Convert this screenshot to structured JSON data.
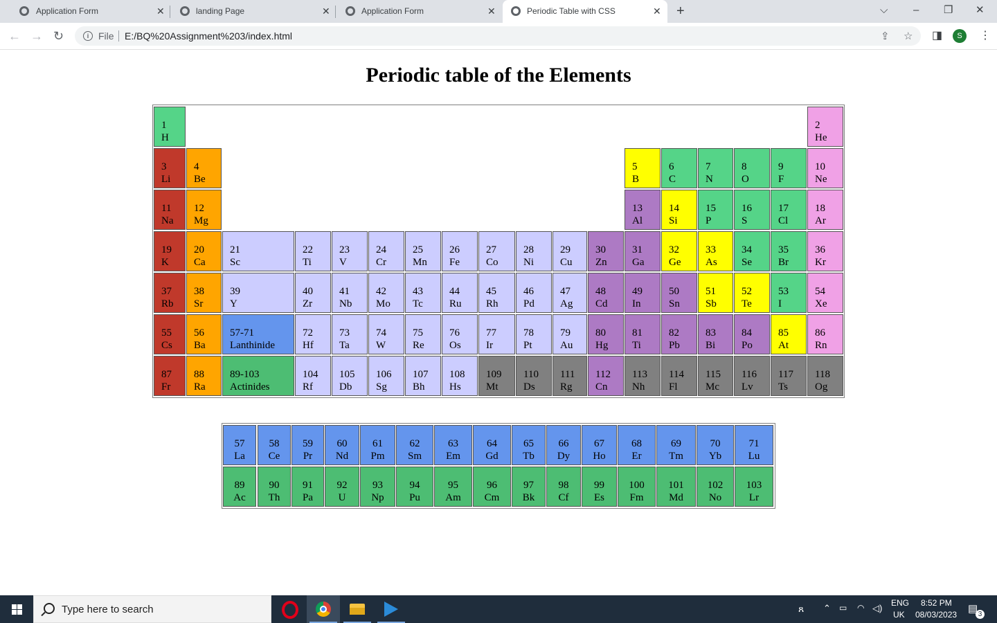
{
  "browser": {
    "tabs": [
      {
        "title": "Application Form",
        "close": "✕"
      },
      {
        "title": "landing Page",
        "close": "✕"
      },
      {
        "title": "Application Form",
        "close": "✕"
      },
      {
        "title": "Periodic Table with CSS",
        "close": "✕"
      }
    ],
    "new_tab": "+",
    "window_controls": {
      "tab_search": "⌵",
      "minimize": "–",
      "restore": "❐",
      "close": "✕"
    },
    "nav": {
      "back": "←",
      "forward": "→",
      "reload": "↻"
    },
    "omnibox": {
      "info": "i",
      "scheme": "File",
      "url": "E:/BQ%20Assignment%203/index.html"
    },
    "profile_initial": "S"
  },
  "page": {
    "title": "Periodic table of the Elements"
  },
  "colors": {
    "alkali": "#c0392b",
    "alkaline": "#ffa500",
    "transition": "#cccdff",
    "post_transition": "#ad7ac4",
    "metalloid": "#ffff00",
    "nonmetal": "#55d488",
    "noble": "#f0a1e6",
    "lanthanide": "#6495ed",
    "actinide": "#4dbd73",
    "unknown": "#808080"
  },
  "main_table": [
    {
      "num": "1",
      "sym": "H",
      "cat": "nonmetal",
      "row": 1,
      "col": 1
    },
    {
      "num": "2",
      "sym": "He",
      "cat": "noble",
      "row": 1,
      "col": 18
    },
    {
      "num": "3",
      "sym": "Li",
      "cat": "alkali",
      "row": 2,
      "col": 1
    },
    {
      "num": "4",
      "sym": "Be",
      "cat": "alkaline",
      "row": 2,
      "col": 2
    },
    {
      "num": "5",
      "sym": "B",
      "cat": "metalloid",
      "row": 2,
      "col": 13
    },
    {
      "num": "6",
      "sym": "C",
      "cat": "nonmetal",
      "row": 2,
      "col": 14
    },
    {
      "num": "7",
      "sym": "N",
      "cat": "nonmetal",
      "row": 2,
      "col": 15
    },
    {
      "num": "8",
      "sym": "O",
      "cat": "nonmetal",
      "row": 2,
      "col": 16
    },
    {
      "num": "9",
      "sym": "F",
      "cat": "nonmetal",
      "row": 2,
      "col": 17
    },
    {
      "num": "10",
      "sym": "Ne",
      "cat": "noble",
      "row": 2,
      "col": 18
    },
    {
      "num": "11",
      "sym": "Na",
      "cat": "alkali",
      "row": 3,
      "col": 1
    },
    {
      "num": "12",
      "sym": "Mg",
      "cat": "alkaline",
      "row": 3,
      "col": 2
    },
    {
      "num": "13",
      "sym": "Al",
      "cat": "post_transition",
      "row": 3,
      "col": 13
    },
    {
      "num": "14",
      "sym": "Si",
      "cat": "metalloid",
      "row": 3,
      "col": 14
    },
    {
      "num": "15",
      "sym": "P",
      "cat": "nonmetal",
      "row": 3,
      "col": 15
    },
    {
      "num": "16",
      "sym": "S",
      "cat": "nonmetal",
      "row": 3,
      "col": 16
    },
    {
      "num": "17",
      "sym": "Cl",
      "cat": "nonmetal",
      "row": 3,
      "col": 17
    },
    {
      "num": "18",
      "sym": "Ar",
      "cat": "noble",
      "row": 3,
      "col": 18
    },
    {
      "num": "19",
      "sym": "K",
      "cat": "alkali",
      "row": 4,
      "col": 1
    },
    {
      "num": "20",
      "sym": "Ca",
      "cat": "alkaline",
      "row": 4,
      "col": 2
    },
    {
      "num": "21",
      "sym": "Sc",
      "cat": "transition",
      "row": 4,
      "col": 3
    },
    {
      "num": "22",
      "sym": "Ti",
      "cat": "transition",
      "row": 4,
      "col": 4
    },
    {
      "num": "23",
      "sym": "V",
      "cat": "transition",
      "row": 4,
      "col": 5
    },
    {
      "num": "24",
      "sym": "Cr",
      "cat": "transition",
      "row": 4,
      "col": 6
    },
    {
      "num": "25",
      "sym": "Mn",
      "cat": "transition",
      "row": 4,
      "col": 7
    },
    {
      "num": "26",
      "sym": "Fe",
      "cat": "transition",
      "row": 4,
      "col": 8
    },
    {
      "num": "27",
      "sym": "Co",
      "cat": "transition",
      "row": 4,
      "col": 9
    },
    {
      "num": "28",
      "sym": "Ni",
      "cat": "transition",
      "row": 4,
      "col": 10
    },
    {
      "num": "29",
      "sym": "Cu",
      "cat": "transition",
      "row": 4,
      "col": 11
    },
    {
      "num": "30",
      "sym": "Zn",
      "cat": "post_transition",
      "row": 4,
      "col": 12
    },
    {
      "num": "31",
      "sym": "Ga",
      "cat": "post_transition",
      "row": 4,
      "col": 13
    },
    {
      "num": "32",
      "sym": "Ge",
      "cat": "metalloid",
      "row": 4,
      "col": 14
    },
    {
      "num": "33",
      "sym": "As",
      "cat": "metalloid",
      "row": 4,
      "col": 15
    },
    {
      "num": "34",
      "sym": "Se",
      "cat": "nonmetal",
      "row": 4,
      "col": 16
    },
    {
      "num": "35",
      "sym": "Br",
      "cat": "nonmetal",
      "row": 4,
      "col": 17
    },
    {
      "num": "36",
      "sym": "Kr",
      "cat": "noble",
      "row": 4,
      "col": 18
    },
    {
      "num": "37",
      "sym": "Rb",
      "cat": "alkali",
      "row": 5,
      "col": 1
    },
    {
      "num": "38",
      "sym": "Sr",
      "cat": "alkaline",
      "row": 5,
      "col": 2
    },
    {
      "num": "39",
      "sym": "Y",
      "cat": "transition",
      "row": 5,
      "col": 3
    },
    {
      "num": "40",
      "sym": "Zr",
      "cat": "transition",
      "row": 5,
      "col": 4
    },
    {
      "num": "41",
      "sym": "Nb",
      "cat": "transition",
      "row": 5,
      "col": 5
    },
    {
      "num": "42",
      "sym": "Mo",
      "cat": "transition",
      "row": 5,
      "col": 6
    },
    {
      "num": "43",
      "sym": "Tc",
      "cat": "transition",
      "row": 5,
      "col": 7
    },
    {
      "num": "44",
      "sym": "Ru",
      "cat": "transition",
      "row": 5,
      "col": 8
    },
    {
      "num": "45",
      "sym": "Rh",
      "cat": "transition",
      "row": 5,
      "col": 9
    },
    {
      "num": "46",
      "sym": "Pd",
      "cat": "transition",
      "row": 5,
      "col": 10
    },
    {
      "num": "47",
      "sym": "Ag",
      "cat": "transition",
      "row": 5,
      "col": 11
    },
    {
      "num": "48",
      "sym": "Cd",
      "cat": "post_transition",
      "row": 5,
      "col": 12
    },
    {
      "num": "49",
      "sym": "In",
      "cat": "post_transition",
      "row": 5,
      "col": 13
    },
    {
      "num": "50",
      "sym": "Sn",
      "cat": "post_transition",
      "row": 5,
      "col": 14
    },
    {
      "num": "51",
      "sym": "Sb",
      "cat": "metalloid",
      "row": 5,
      "col": 15
    },
    {
      "num": "52",
      "sym": "Te",
      "cat": "metalloid",
      "row": 5,
      "col": 16
    },
    {
      "num": "53",
      "sym": "I",
      "cat": "nonmetal",
      "row": 5,
      "col": 17
    },
    {
      "num": "54",
      "sym": "Xe",
      "cat": "noble",
      "row": 5,
      "col": 18
    },
    {
      "num": "55",
      "sym": "Cs",
      "cat": "alkali",
      "row": 6,
      "col": 1
    },
    {
      "num": "56",
      "sym": "Ba",
      "cat": "alkaline",
      "row": 6,
      "col": 2
    },
    {
      "num": "57-71",
      "sym": "Lanthinide",
      "cat": "lanthanide",
      "row": 6,
      "col": 3
    },
    {
      "num": "72",
      "sym": "Hf",
      "cat": "transition",
      "row": 6,
      "col": 4
    },
    {
      "num": "73",
      "sym": "Ta",
      "cat": "transition",
      "row": 6,
      "col": 5
    },
    {
      "num": "74",
      "sym": "W",
      "cat": "transition",
      "row": 6,
      "col": 6
    },
    {
      "num": "75",
      "sym": "Re",
      "cat": "transition",
      "row": 6,
      "col": 7
    },
    {
      "num": "76",
      "sym": "Os",
      "cat": "transition",
      "row": 6,
      "col": 8
    },
    {
      "num": "77",
      "sym": "Ir",
      "cat": "transition",
      "row": 6,
      "col": 9
    },
    {
      "num": "78",
      "sym": "Pt",
      "cat": "transition",
      "row": 6,
      "col": 10
    },
    {
      "num": "79",
      "sym": "Au",
      "cat": "transition",
      "row": 6,
      "col": 11
    },
    {
      "num": "80",
      "sym": "Hg",
      "cat": "post_transition",
      "row": 6,
      "col": 12
    },
    {
      "num": "81",
      "sym": "Ti",
      "cat": "post_transition",
      "row": 6,
      "col": 13
    },
    {
      "num": "82",
      "sym": "Pb",
      "cat": "post_transition",
      "row": 6,
      "col": 14
    },
    {
      "num": "83",
      "sym": "Bi",
      "cat": "post_transition",
      "row": 6,
      "col": 15
    },
    {
      "num": "84",
      "sym": "Po",
      "cat": "post_transition",
      "row": 6,
      "col": 16
    },
    {
      "num": "85",
      "sym": "At",
      "cat": "metalloid",
      "row": 6,
      "col": 17
    },
    {
      "num": "86",
      "sym": "Rn",
      "cat": "noble",
      "row": 6,
      "col": 18
    },
    {
      "num": "87",
      "sym": "Fr",
      "cat": "alkali",
      "row": 7,
      "col": 1
    },
    {
      "num": "88",
      "sym": "Ra",
      "cat": "alkaline",
      "row": 7,
      "col": 2
    },
    {
      "num": "89-103",
      "sym": "Actinides",
      "cat": "actinide",
      "row": 7,
      "col": 3
    },
    {
      "num": "104",
      "sym": "Rf",
      "cat": "transition",
      "row": 7,
      "col": 4
    },
    {
      "num": "105",
      "sym": "Db",
      "cat": "transition",
      "row": 7,
      "col": 5
    },
    {
      "num": "106",
      "sym": "Sg",
      "cat": "transition",
      "row": 7,
      "col": 6
    },
    {
      "num": "107",
      "sym": "Bh",
      "cat": "transition",
      "row": 7,
      "col": 7
    },
    {
      "num": "108",
      "sym": "Hs",
      "cat": "transition",
      "row": 7,
      "col": 8
    },
    {
      "num": "109",
      "sym": "Mt",
      "cat": "unknown",
      "row": 7,
      "col": 9
    },
    {
      "num": "110",
      "sym": "Ds",
      "cat": "unknown",
      "row": 7,
      "col": 10
    },
    {
      "num": "111",
      "sym": "Rg",
      "cat": "unknown",
      "row": 7,
      "col": 11
    },
    {
      "num": "112",
      "sym": "Cn",
      "cat": "post_transition",
      "row": 7,
      "col": 12
    },
    {
      "num": "113",
      "sym": "Nh",
      "cat": "unknown",
      "row": 7,
      "col": 13
    },
    {
      "num": "114",
      "sym": "Fl",
      "cat": "unknown",
      "row": 7,
      "col": 14
    },
    {
      "num": "115",
      "sym": "Mc",
      "cat": "unknown",
      "row": 7,
      "col": 15
    },
    {
      "num": "116",
      "sym": "Lv",
      "cat": "unknown",
      "row": 7,
      "col": 16
    },
    {
      "num": "117",
      "sym": "Ts",
      "cat": "unknown",
      "row": 7,
      "col": 17
    },
    {
      "num": "118",
      "sym": "Og",
      "cat": "unknown",
      "row": 7,
      "col": 18
    }
  ],
  "series_table": {
    "lanthanides": [
      {
        "num": "57",
        "sym": "La"
      },
      {
        "num": "58",
        "sym": "Ce"
      },
      {
        "num": "59",
        "sym": "Pr"
      },
      {
        "num": "60",
        "sym": "Nd"
      },
      {
        "num": "61",
        "sym": "Pm"
      },
      {
        "num": "62",
        "sym": "Sm"
      },
      {
        "num": "63",
        "sym": "Em"
      },
      {
        "num": "64",
        "sym": "Gd"
      },
      {
        "num": "65",
        "sym": "Tb"
      },
      {
        "num": "66",
        "sym": "Dy"
      },
      {
        "num": "67",
        "sym": "Ho"
      },
      {
        "num": "68",
        "sym": "Er"
      },
      {
        "num": "69",
        "sym": "Tm"
      },
      {
        "num": "70",
        "sym": "Yb"
      },
      {
        "num": "71",
        "sym": "Lu"
      }
    ],
    "actinides": [
      {
        "num": "89",
        "sym": "Ac"
      },
      {
        "num": "90",
        "sym": "Th"
      },
      {
        "num": "91",
        "sym": "Pa"
      },
      {
        "num": "92",
        "sym": "U"
      },
      {
        "num": "93",
        "sym": "Np"
      },
      {
        "num": "94",
        "sym": "Pu"
      },
      {
        "num": "95",
        "sym": "Am"
      },
      {
        "num": "96",
        "sym": "Cm"
      },
      {
        "num": "97",
        "sym": "Bk"
      },
      {
        "num": "98",
        "sym": "Cf"
      },
      {
        "num": "99",
        "sym": "Es"
      },
      {
        "num": "100",
        "sym": "Fm"
      },
      {
        "num": "101",
        "sym": "Md"
      },
      {
        "num": "102",
        "sym": "No"
      },
      {
        "num": "103",
        "sym": "Lr"
      }
    ]
  },
  "taskbar": {
    "search_placeholder": "Type here to search",
    "apps": [
      "opera-icon",
      "chrome-icon",
      "file-explorer-icon",
      "vscode-icon"
    ],
    "lang": "ENG",
    "region": "UK",
    "time": "8:52 PM",
    "date": "08/03/2023",
    "notifications": "3"
  }
}
